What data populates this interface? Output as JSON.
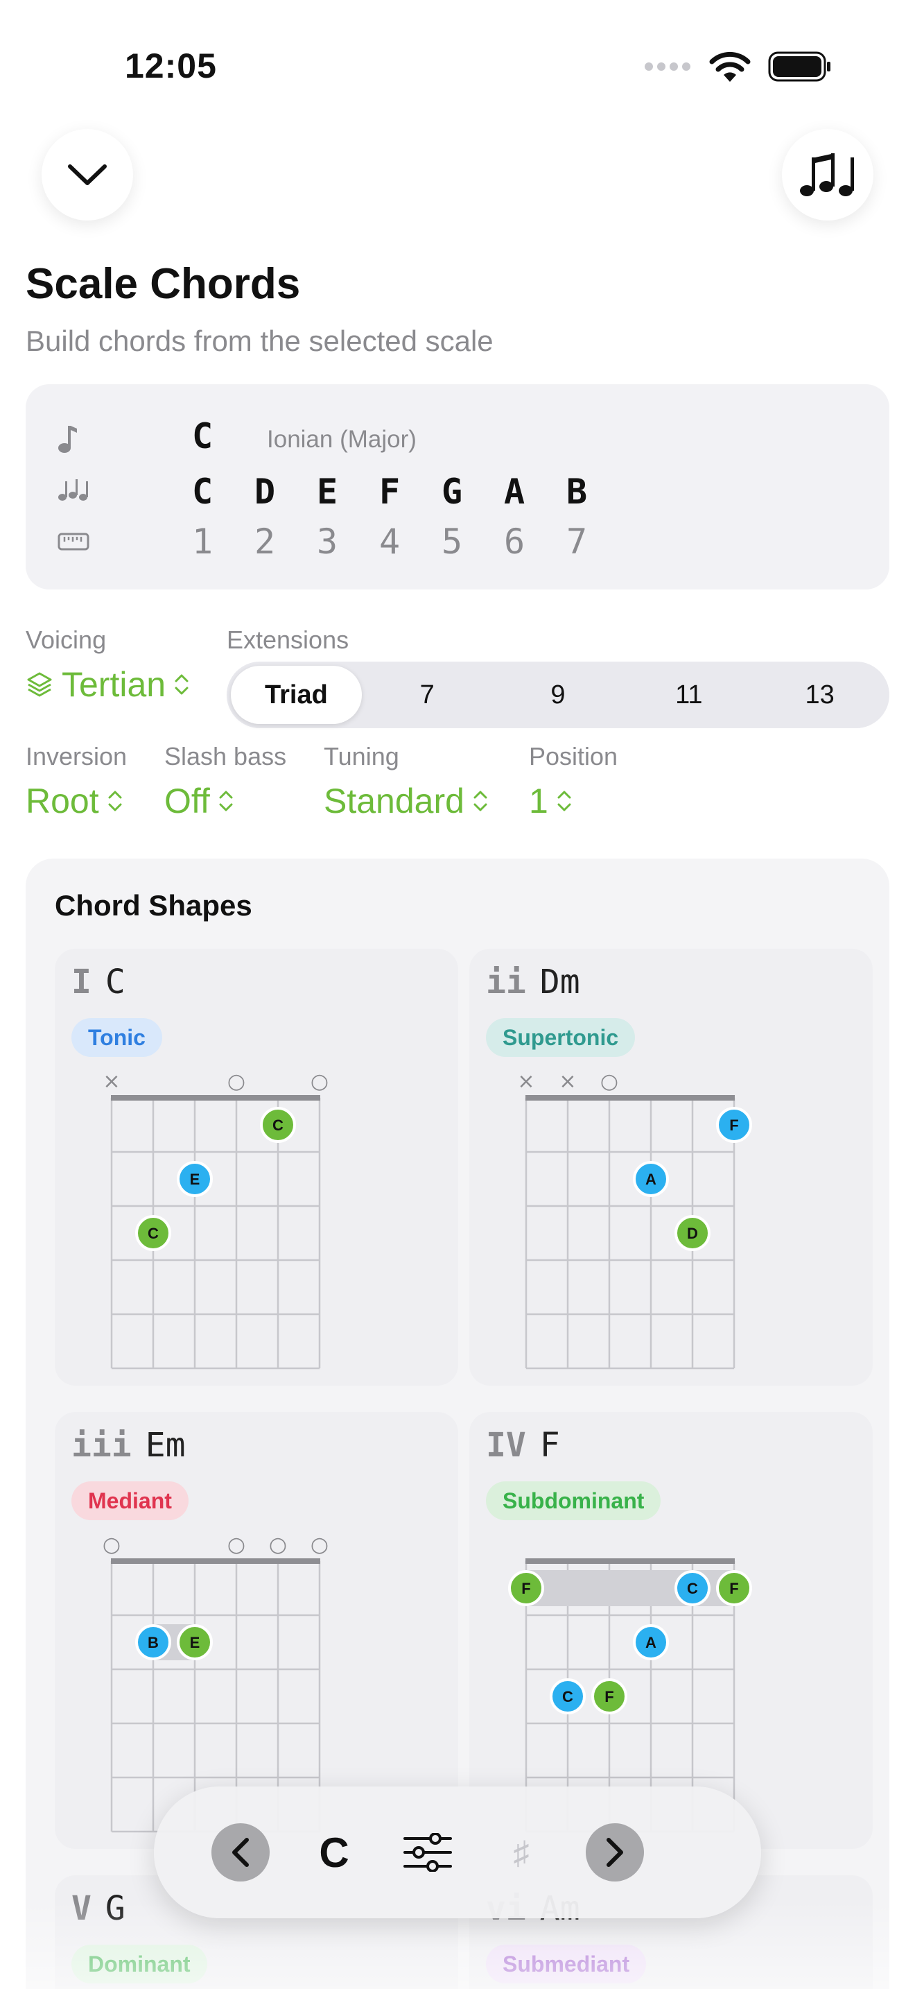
{
  "status_bar": {
    "time": "12:05"
  },
  "header": {
    "collapse_icon": "chevron-down-icon",
    "notes_icon": "music-notes-icon",
    "title": "Scale Chords",
    "subtitle": "Build chords from the selected scale"
  },
  "scale": {
    "root": "C",
    "mode": "Ionian (Major)",
    "notes": [
      "C",
      "D",
      "E",
      "F",
      "G",
      "A",
      "B"
    ],
    "degrees": [
      "1",
      "2",
      "3",
      "4",
      "5",
      "6",
      "7"
    ]
  },
  "controls": {
    "voicing": {
      "label": "Voicing",
      "value": "Tertian"
    },
    "extensions": {
      "label": "Extensions",
      "options": [
        "Triad",
        "7",
        "9",
        "11",
        "13"
      ],
      "selected": "Triad"
    },
    "inversion": {
      "label": "Inversion",
      "value": "Root"
    },
    "slash_bass": {
      "label": "Slash bass",
      "value": "Off"
    },
    "tuning": {
      "label": "Tuning",
      "value": "Standard"
    },
    "position": {
      "label": "Position",
      "value": "1"
    }
  },
  "chord_shapes": {
    "title": "Chord Shapes",
    "chords": [
      {
        "numeral": "I",
        "name": "C",
        "function": "Tonic",
        "badge_bg": "#d9e8fb",
        "badge_fg": "#2f7fe0",
        "markers": [
          "×",
          "",
          "",
          "○",
          "",
          "○"
        ],
        "dots": [
          {
            "string": 5,
            "fret": 1,
            "note": "C",
            "color": "green"
          },
          {
            "string": 3,
            "fret": 2,
            "note": "E",
            "color": "blue"
          },
          {
            "string": 2,
            "fret": 3,
            "note": "C",
            "color": "green"
          }
        ],
        "barres": []
      },
      {
        "numeral": "ii",
        "name": "Dm",
        "function": "Supertonic",
        "badge_bg": "#d6ecea",
        "badge_fg": "#2f9a8f",
        "markers": [
          "×",
          "×",
          "○",
          "",
          "",
          ""
        ],
        "dots": [
          {
            "string": 6,
            "fret": 1,
            "note": "F",
            "color": "blue"
          },
          {
            "string": 4,
            "fret": 2,
            "note": "A",
            "color": "blue"
          },
          {
            "string": 5,
            "fret": 3,
            "note": "D",
            "color": "green"
          }
        ],
        "barres": []
      },
      {
        "numeral": "iii",
        "name": "Em",
        "function": "Mediant",
        "badge_bg": "#f9d9de",
        "badge_fg": "#e0344f",
        "markers": [
          "○",
          "",
          "",
          "○",
          "○",
          "○"
        ],
        "dots": [
          {
            "string": 2,
            "fret": 2,
            "note": "B",
            "color": "blue"
          },
          {
            "string": 3,
            "fret": 2,
            "note": "E",
            "color": "green"
          }
        ],
        "barres": [
          {
            "fret": 2,
            "from": 2,
            "to": 3
          }
        ]
      },
      {
        "numeral": "IV",
        "name": "F",
        "function": "Subdominant",
        "badge_bg": "#dbf0dc",
        "badge_fg": "#38b24a",
        "markers": [
          "",
          "",
          "",
          "",
          "",
          ""
        ],
        "dots": [
          {
            "string": 1,
            "fret": 1,
            "note": "F",
            "color": "green"
          },
          {
            "string": 5,
            "fret": 1,
            "note": "C",
            "color": "blue"
          },
          {
            "string": 6,
            "fret": 1,
            "note": "F",
            "color": "green"
          },
          {
            "string": 4,
            "fret": 2,
            "note": "A",
            "color": "blue"
          },
          {
            "string": 2,
            "fret": 3,
            "note": "C",
            "color": "blue"
          },
          {
            "string": 3,
            "fret": 3,
            "note": "F",
            "color": "green"
          }
        ],
        "barres": [
          {
            "fret": 1,
            "from": 1,
            "to": 6
          }
        ]
      },
      {
        "numeral": "V",
        "name": "G",
        "function": "Dominant",
        "badge_bg": "#e0f3e2",
        "badge_fg": "#5cc06a",
        "markers": [
          "",
          "",
          "",
          "",
          "",
          ""
        ],
        "dots": [],
        "barres": []
      },
      {
        "numeral": "vi",
        "name": "Am",
        "function": "Submediant",
        "badge_bg": "#efe2f7",
        "badge_fg": "#b07ad6",
        "markers": [
          "",
          "",
          "",
          "",
          "",
          ""
        ],
        "dots": [],
        "barres": []
      }
    ]
  },
  "toolbar": {
    "prev_icon": "chevron-left-icon",
    "root": "C",
    "settings_icon": "sliders-icon",
    "sharp": "♯",
    "next_icon": "chevron-right-icon"
  },
  "colors": {
    "accent": "#6dbb3a",
    "dot_green": "#6dbb3a",
    "dot_blue": "#2bb0f0",
    "secondary_text": "#8a8a8e"
  }
}
